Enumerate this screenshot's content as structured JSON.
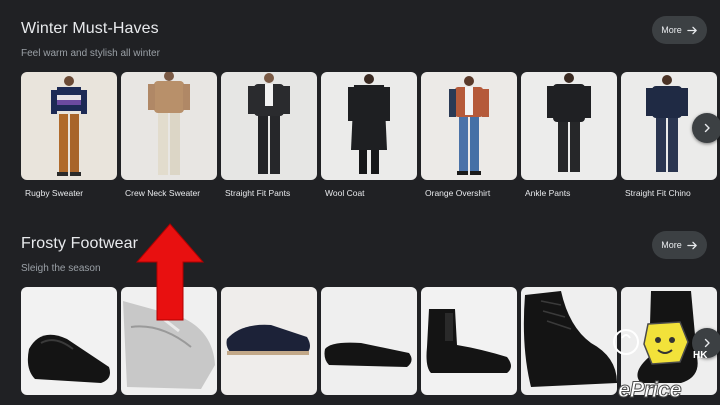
{
  "sections": [
    {
      "title": "Winter Must-Haves",
      "subtitle": "Feel warm and stylish all winter",
      "more_label": "More",
      "items": [
        {
          "label": "Rugby Sweater"
        },
        {
          "label": "Crew Neck Sweater"
        },
        {
          "label": "Straight Fit Pants"
        },
        {
          "label": "Wool Coat"
        },
        {
          "label": "Orange Overshirt"
        },
        {
          "label": "Ankle Pants"
        },
        {
          "label": "Straight Fit Chino"
        }
      ]
    },
    {
      "title": "Frosty Footwear",
      "subtitle": "Sleigh the season",
      "more_label": "More",
      "items": [
        {
          "label": "Black penny loafer"
        },
        {
          "label": "Silver brogue"
        },
        {
          "label": "Navy suede sneaker"
        },
        {
          "label": "Black suede loafer"
        },
        {
          "label": "Chelsea boot"
        },
        {
          "label": "Lace-up boot"
        },
        {
          "label": "Boot"
        }
      ]
    }
  ],
  "icons": {
    "more": "arrow-right-icon",
    "next": "chevron-right-icon",
    "annotation": "red-arrow-up-icon"
  },
  "watermark": {
    "text": "ePrice",
    "region": "HK"
  },
  "colors": {
    "background": "#202124",
    "button": "#3c4043",
    "text": "#e8eaed",
    "subtext": "#9aa0a6",
    "annotation": "#e81010"
  }
}
